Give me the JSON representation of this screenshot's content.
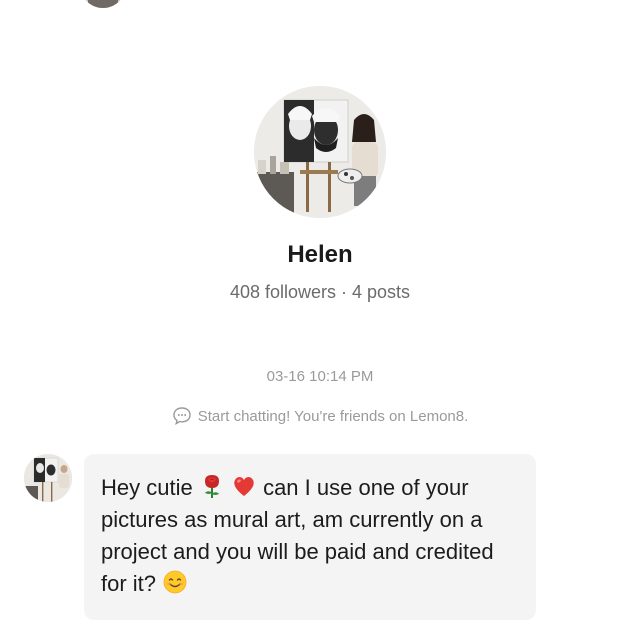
{
  "profile": {
    "name": "Helen",
    "stats": "408 followers · 4 posts"
  },
  "conversation": {
    "timestamp": "03-16 10:14 PM",
    "system_note": "Start chatting! You're friends on Lemon8.",
    "message": {
      "part1": "Hey cutie ",
      "part2": " can I use one of your pictures as mural art, am currently on a project and you will be paid and credited for it? ",
      "emojis": [
        "rose-emoji",
        "red-heart-emoji",
        "smiling-face-emoji"
      ]
    }
  },
  "icons": {
    "system_note_icon": "chat-bubble-icon"
  },
  "colors": {
    "background": "#ffffff",
    "bubble": "#f4f4f4",
    "muted_text": "#9a9a9a",
    "primary_text": "#1a1a1a"
  }
}
